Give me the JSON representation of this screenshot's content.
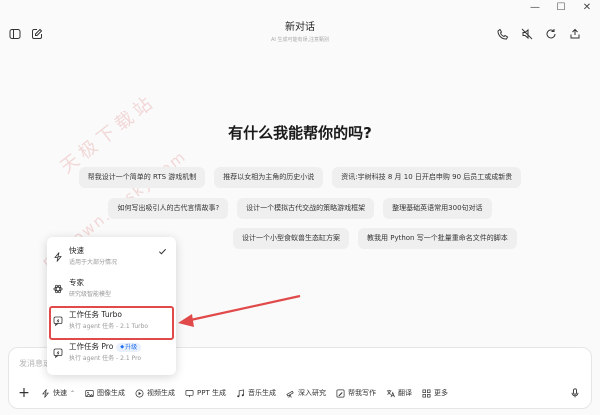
{
  "window": {
    "title": "新对话",
    "subtitle": "AI 生成可能有误,注意甄别"
  },
  "heading": "有什么我能帮你的吗?",
  "suggestions": {
    "row1": [
      "帮我设计一个简单的 RTS 游戏机制",
      "推荐以女相为主角的历史小说",
      "资讯:宇树科技 8 月 10 日开启申购 90 后员工或成新贵"
    ],
    "row2": [
      "如何写出吸引人的古代言情故事?",
      "设计一个模拟古代交战的策略游戏框架",
      "整理基础英语常用300句对话"
    ],
    "row3": [
      "设计一个小型食蚁兽生态缸方案",
      "教我用 Python 写一个批量重命名文件的脚本"
    ]
  },
  "mode_menu": {
    "items": [
      {
        "label": "快速",
        "desc": "适用于大部分情况",
        "selected": true
      },
      {
        "label": "专家",
        "desc": "研究级智能模型"
      },
      {
        "label": "工作任务 Turbo",
        "desc": "执行 agent 任务 - 2.1 Turbo"
      },
      {
        "label": "工作任务 Pro",
        "desc": "执行 agent 任务 - 2.1 Pro",
        "badge": "升级"
      }
    ]
  },
  "input": {
    "placeholder": "发消息或"
  },
  "toolbar": {
    "mode": "快速",
    "items": [
      "图像生成",
      "视频生成",
      "PPT 生成",
      "音乐生成",
      "深入研究",
      "帮我写作",
      "翻译",
      "更多"
    ]
  },
  "watermark": {
    "cn": "天极下载站",
    "url": "mydown.yesky.com"
  },
  "colors": {
    "highlight": "#e04a4a",
    "badge": "#1e6ef0"
  }
}
